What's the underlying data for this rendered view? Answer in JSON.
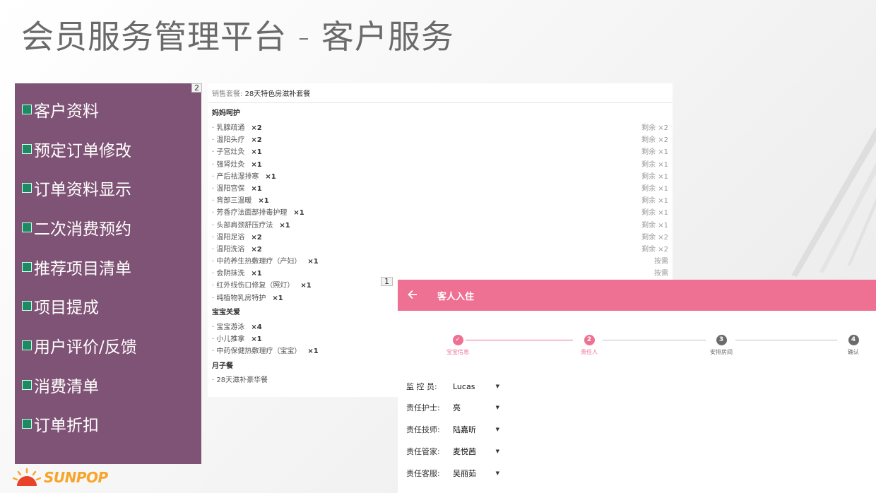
{
  "slide": {
    "title": "会员服务管理平台 - 客户服务"
  },
  "menu": {
    "badge": "2",
    "items": [
      {
        "label": "客户资料"
      },
      {
        "label": "预定订单修改"
      },
      {
        "label": "订单资料显示"
      },
      {
        "label": "二次消费预约"
      },
      {
        "label": "推荐项目清单"
      },
      {
        "label": "项目提成"
      },
      {
        "label": "用户评价/反馈"
      },
      {
        "label": "消费清单"
      },
      {
        "label": "订单折扣"
      }
    ]
  },
  "package": {
    "label": "销售套餐:",
    "name": "28天特色房滋补套餐",
    "sections": [
      {
        "title": "妈妈呵护",
        "items": [
          {
            "name": "· 乳腺疏通",
            "qty": "×2",
            "remain": "剩余 ×2"
          },
          {
            "name": "· 温阳头疗",
            "qty": "×2",
            "remain": "剩余 ×2"
          },
          {
            "name": "· 子宫灶灸",
            "qty": "×1",
            "remain": "剩余 ×1"
          },
          {
            "name": "· 强肾灶灸",
            "qty": "×1",
            "remain": "剩余 ×1"
          },
          {
            "name": "· 产后祛湿排寒",
            "qty": "×1",
            "remain": "剩余 ×1"
          },
          {
            "name": "· 温阳宫保",
            "qty": "×1",
            "remain": "剩余 ×1"
          },
          {
            "name": "· 背部三温暖",
            "qty": "×1",
            "remain": "剩余 ×1"
          },
          {
            "name": "· 芳香疗法面部排毒护理",
            "qty": "×1",
            "remain": "剩余 ×1"
          },
          {
            "name": "· 头部肩颈舒压疗法",
            "qty": "×1",
            "remain": "剩余 ×1"
          },
          {
            "name": "· 温阳足浴",
            "qty": "×2",
            "remain": "剩余 ×2"
          },
          {
            "name": "· 温阳洗浴",
            "qty": "×2",
            "remain": "剩余 ×2"
          },
          {
            "name": "· 中药养生热敷理疗（产妇）",
            "qty": "×1",
            "remain": "按需"
          },
          {
            "name": "· 会阴抹洗",
            "qty": "×1",
            "remain": "按需"
          },
          {
            "name": "· 红外线伤口修复（照灯）",
            "qty": "×1",
            "remain": ""
          },
          {
            "name": "· 纯植物乳房特护",
            "qty": "×1",
            "remain": ""
          }
        ]
      },
      {
        "title": "宝宝关爱",
        "items": [
          {
            "name": "· 宝宝游泳",
            "qty": "×4",
            "remain": ""
          },
          {
            "name": "· 小儿推拿",
            "qty": "×1",
            "remain": ""
          },
          {
            "name": "· 中药保健热敷理疗（宝宝）",
            "qty": "×1",
            "remain": ""
          }
        ]
      },
      {
        "title": "月子餐",
        "items": [
          {
            "name": "· 28天滋补豪华餐",
            "qty": "",
            "remain": ""
          }
        ]
      }
    ]
  },
  "dialog": {
    "badge": "1",
    "title": "客人入住",
    "back_icon": "arrow-back-icon",
    "accent_color": "#ee7093",
    "steps": [
      {
        "number": "✓",
        "label": "宝宝信息",
        "state": "done"
      },
      {
        "number": "2",
        "label": "责任人",
        "state": "active"
      },
      {
        "number": "3",
        "label": "安排房间",
        "state": "todo"
      },
      {
        "number": "4",
        "label": "确认",
        "state": "todo"
      }
    ],
    "fields": [
      {
        "label": "监 控 员:",
        "value": "Lucas"
      },
      {
        "label": "责任护士:",
        "value": "亮"
      },
      {
        "label": "责任技师:",
        "value": "陆嘉昕"
      },
      {
        "label": "责任管家:",
        "value": "麦悦茜"
      },
      {
        "label": "责任客服:",
        "value": "吴丽茹"
      }
    ]
  },
  "logo": {
    "text": "SUNPOP"
  }
}
